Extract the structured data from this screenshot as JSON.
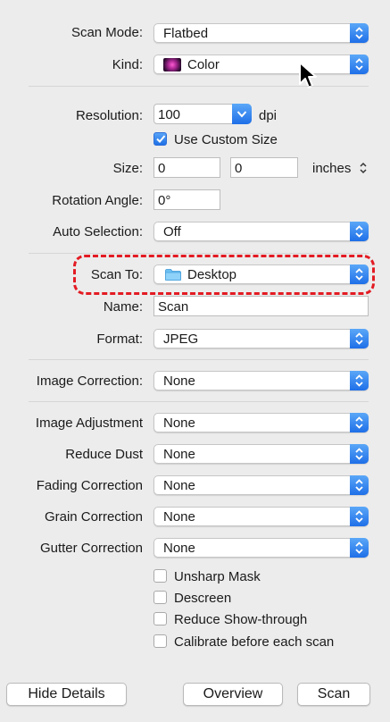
{
  "scan_mode": {
    "label": "Scan Mode:",
    "value": "Flatbed"
  },
  "kind": {
    "label": "Kind:",
    "value": "Color",
    "icon": "color-swatch-icon"
  },
  "resolution": {
    "label": "Resolution:",
    "value": "100",
    "unit": "dpi"
  },
  "use_custom_size": {
    "label": "Use Custom Size",
    "checked": true
  },
  "size": {
    "label": "Size:",
    "width": "0",
    "height": "0",
    "unit": "inches"
  },
  "rotation": {
    "label": "Rotation Angle:",
    "value": "0°"
  },
  "auto_selection": {
    "label": "Auto Selection:",
    "value": "Off"
  },
  "scan_to": {
    "label": "Scan To:",
    "value": "Desktop",
    "icon": "folder-icon"
  },
  "name": {
    "label": "Name:",
    "value": "Scan"
  },
  "format": {
    "label": "Format:",
    "value": "JPEG"
  },
  "image_correction": {
    "label": "Image Correction:",
    "value": "None"
  },
  "image_adjustment": {
    "label": "Image Adjustment",
    "value": "None"
  },
  "reduce_dust": {
    "label": "Reduce Dust",
    "value": "None"
  },
  "fading_correction": {
    "label": "Fading Correction",
    "value": "None"
  },
  "grain_correction": {
    "label": "Grain Correction",
    "value": "None"
  },
  "gutter_correction": {
    "label": "Gutter Correction",
    "value": "None"
  },
  "options": [
    {
      "label": "Unsharp Mask",
      "checked": false
    },
    {
      "label": "Descreen",
      "checked": false
    },
    {
      "label": "Reduce Show-through",
      "checked": false
    },
    {
      "label": "Calibrate before each scan",
      "checked": false
    }
  ],
  "buttons": {
    "hide_details": "Hide Details",
    "overview": "Overview",
    "scan": "Scan"
  },
  "colors": {
    "accent": "#1f6fe8",
    "highlight": "#e31b23"
  }
}
